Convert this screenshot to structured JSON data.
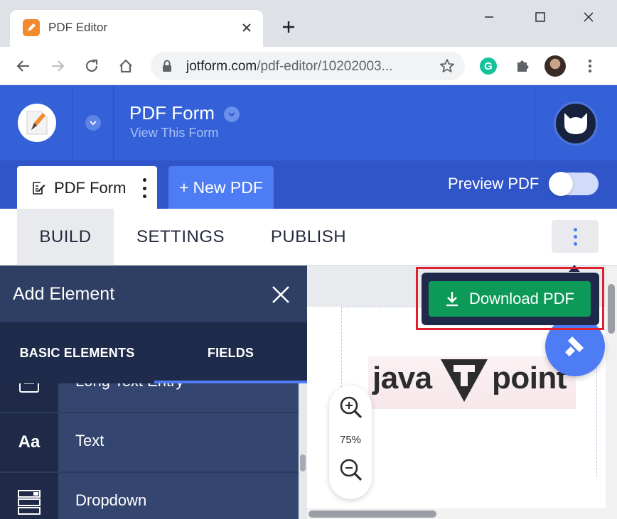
{
  "browser": {
    "tab_title": "PDF Editor",
    "url_host": "jotform.com",
    "url_path": "/pdf-editor/10202003..."
  },
  "header": {
    "form_title": "PDF Form",
    "view_link": "View This Form"
  },
  "tabs": {
    "form_tab_label": "PDF Form",
    "new_pdf_label": "New PDF",
    "new_pdf_plus": "+",
    "preview_label": "Preview PDF",
    "preview_on": false
  },
  "nav": {
    "build": "BUILD",
    "settings": "SETTINGS",
    "publish": "PUBLISH"
  },
  "panel": {
    "title": "Add Element",
    "tab_basic": "BASIC ELEMENTS",
    "tab_fields": "FIELDS",
    "items": [
      {
        "label": "Long Text Entry",
        "icon": "long-text-icon"
      },
      {
        "label": "Text",
        "icon": "text-icon",
        "glyph": "Aa"
      },
      {
        "label": "Dropdown",
        "icon": "dropdown-icon"
      }
    ]
  },
  "canvas": {
    "zoom_level": "75%",
    "logo_text_left": "java",
    "logo_text_right": "point",
    "logo_letter": "T"
  },
  "download": {
    "label": "Download PDF"
  },
  "colors": {
    "brand_blue": "#3461d8",
    "accent_blue": "#4d7cf4",
    "download_green": "#0d9a58",
    "panel_dark": "#2c3a5e",
    "highlight_red": "#e0202e"
  }
}
